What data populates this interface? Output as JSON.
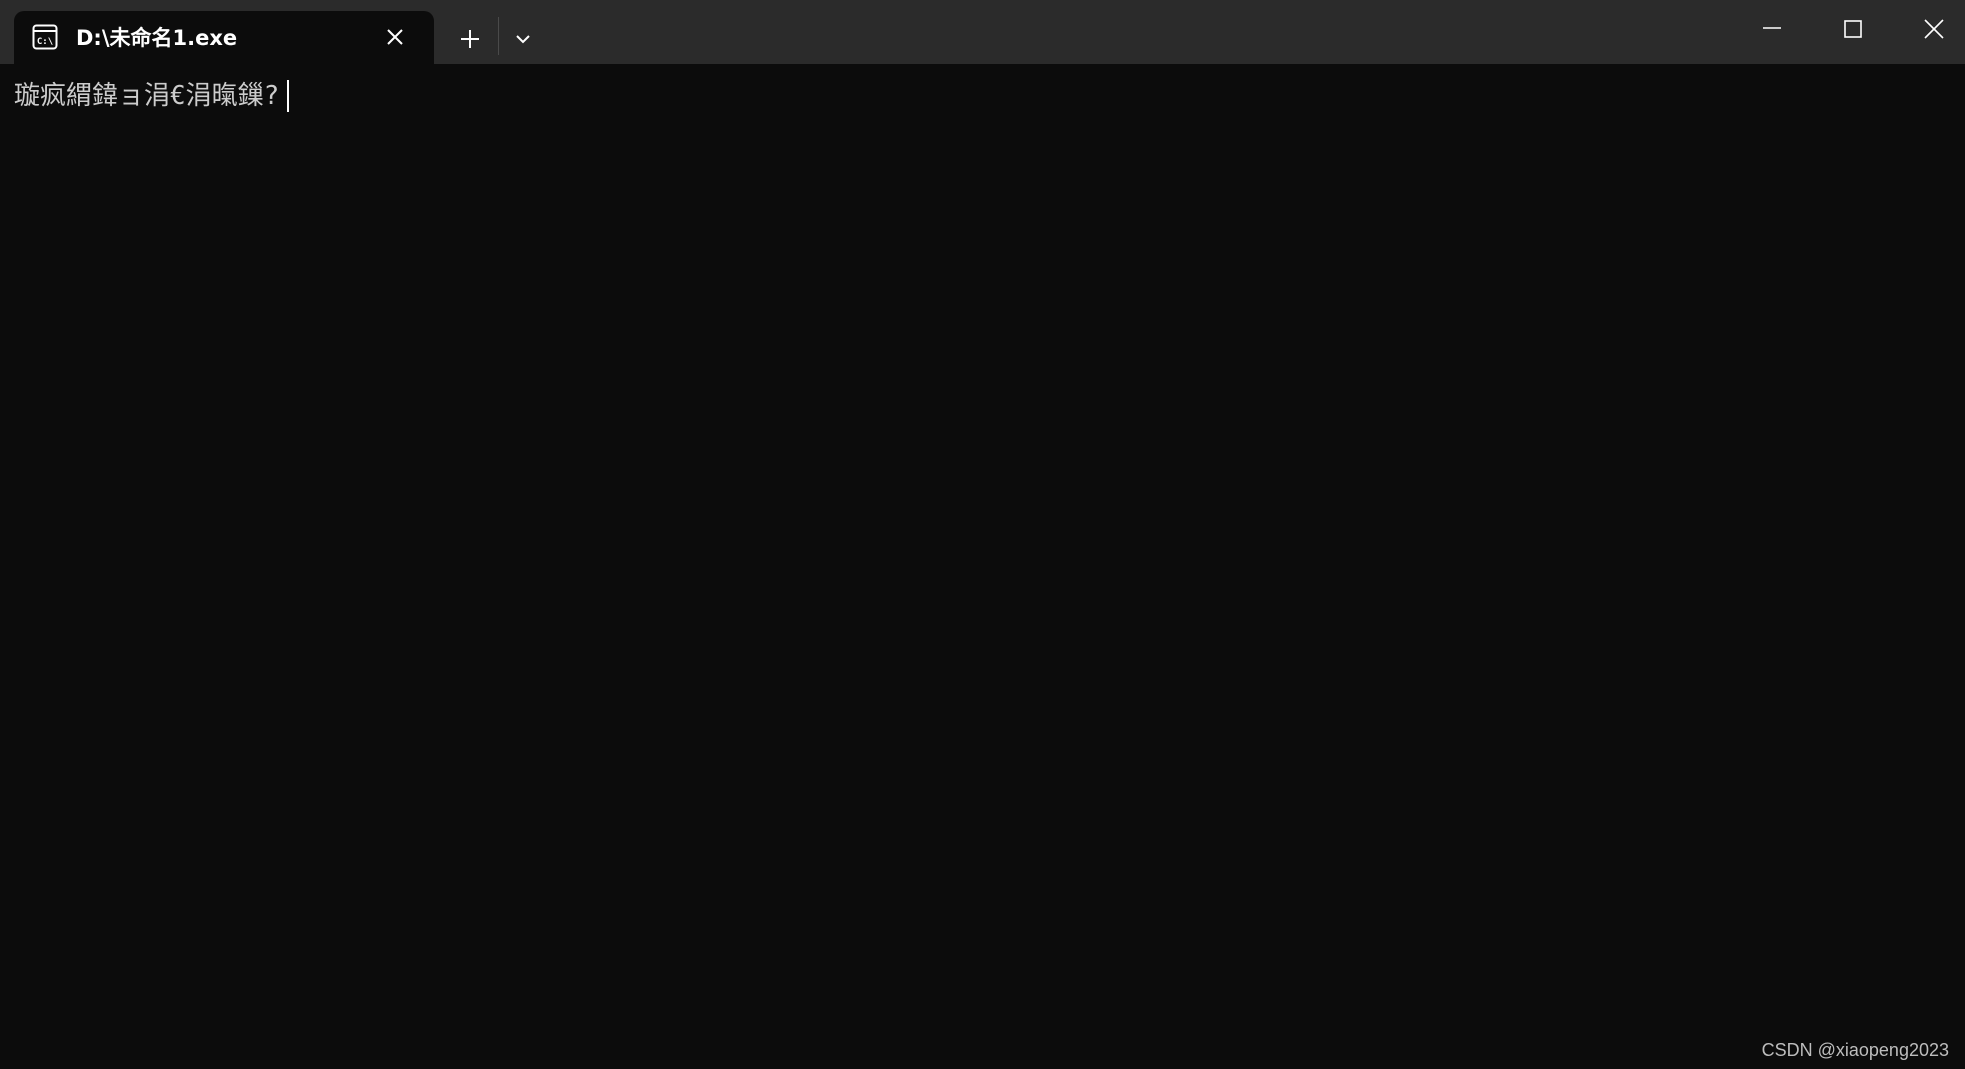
{
  "tab": {
    "title": "D:\\未命名1.exe",
    "icon": "console-icon",
    "icon_text": "C:\\"
  },
  "toolbar": {
    "new_tab_icon": "plus-icon",
    "dropdown_icon": "chevron-down-icon"
  },
  "window_controls": {
    "minimize_icon": "minimize-icon",
    "maximize_icon": "maximize-icon",
    "close_icon": "close-icon"
  },
  "console": {
    "output": "璇疯緭鍏ョ涓€涓暣鏁?"
  },
  "watermark": "CSDN @xiaopeng2023",
  "colors": {
    "titlebar_bg": "#2b2b2b",
    "console_bg": "#0c0c0c",
    "text": "#cccccc"
  }
}
